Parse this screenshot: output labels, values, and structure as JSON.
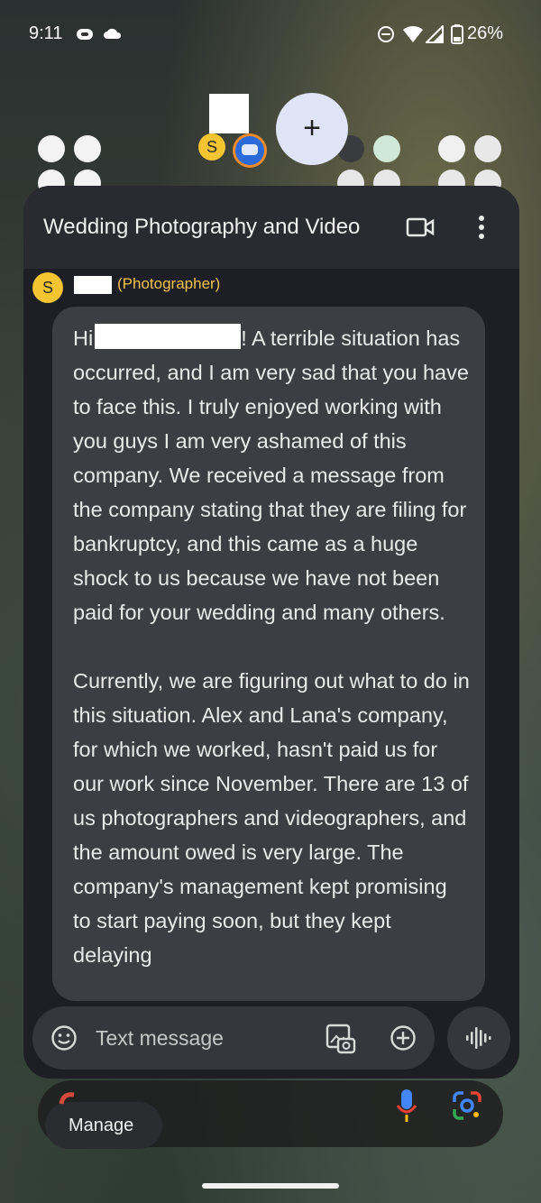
{
  "status_bar": {
    "time": "9:11",
    "battery": "26%",
    "icons": [
      "notification-icon",
      "cloud-icon",
      "do-not-disturb-icon",
      "wifi-icon",
      "signal-icon",
      "battery-icon"
    ]
  },
  "home": {
    "add_button_label": "+",
    "bubble_avatar_letter": "S"
  },
  "conversation": {
    "title": "Wedding Photography and Video",
    "sender": {
      "avatar_letter": "S",
      "role_label": "(Photographer)"
    },
    "message": {
      "greeting": "Hi",
      "body": "! A terrible situation has occurred, and I am very sad that you have to face this. I truly enjoyed working with you guys I am very ashamed of this company. We received a message from the company stating that they are filing for bankruptcy, and this came as a huge shock to us because we have not been paid for your wedding and many others.\n\nCurrently, we are figuring out what to do in this situation. Alex and Lana's company, for which we worked, hasn't paid us for our work since November. There are 13 of us photographers and videographers, and the amount owed is very large. The company's management kept promising to start paying soon, but they kept delaying"
    }
  },
  "composer": {
    "placeholder": "Text message"
  },
  "bottom": {
    "manage_label": "Manage"
  },
  "colors": {
    "accent_yellow": "#f4c531",
    "sender_name": "#f2c14e",
    "panel_bg": "#1e1f24",
    "bubble_bg": "#3d3e44",
    "fab_bg": "#dfe4f6"
  }
}
